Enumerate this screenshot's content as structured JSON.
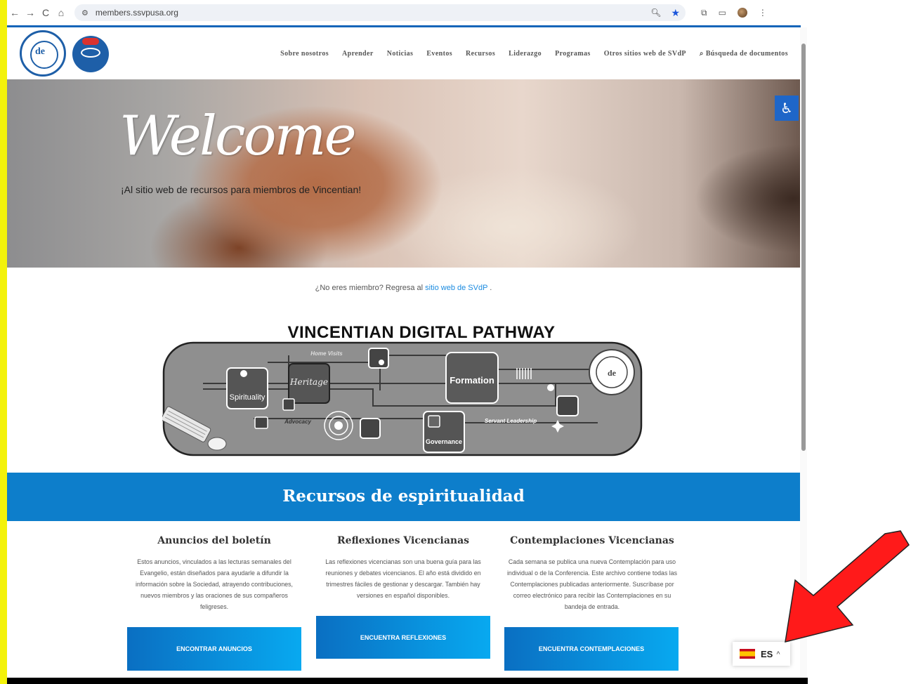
{
  "browser": {
    "url": "members.ssvpusa.org",
    "back_icon": "←",
    "forward_icon": "→",
    "reload_icon": "C",
    "home_icon": "⌂"
  },
  "header": {
    "logo_text": "de",
    "menu": [
      "Sobre nosotros",
      "Aprender",
      "Noticias",
      "Eventos",
      "Recursos",
      "Liderazgo",
      "Programas",
      "Otros sitios web de SVdP",
      "Búsqueda de documentos"
    ]
  },
  "hero": {
    "welcome": "Welcome",
    "subtitle": "¡Al sitio web de recursos para miembros de Vincentian!"
  },
  "notmember": {
    "prefix": "¿No eres miembro? Regresa al ",
    "link": "sitio web de SVdP",
    "suffix": " ."
  },
  "pathway": {
    "title": "VINCENTIAN DIGITAL PATHWAY",
    "labels": {
      "home_visits": "Home Visits",
      "heritage": "Heritage",
      "spirituality": "Spirituality",
      "advocacy": "Advocacy",
      "formation": "Formation",
      "governance": "Governance",
      "servant_leadership": "Servant Leadership",
      "logo_mark": "de"
    }
  },
  "resources": {
    "band_title": "Recursos de espiritualidad",
    "columns": [
      {
        "title": "Anuncios del boletín",
        "text": "Estos anuncios, vinculados a las lecturas semanales del Evangelio, están diseñados para ayudarle a difundir la información sobre la Sociedad, atrayendo contribuciones, nuevos miembros y las oraciones de sus compañeros feligreses.",
        "button": "ENCONTRAR ANUNCIOS"
      },
      {
        "title": "Reflexiones Vicencianas",
        "text": "Las reflexiones vicencianas son una buena guía para las reuniones y debates vicencianos. El año está dividido en trimestres fáciles de gestionar y descargar. También hay versiones en español disponibles.",
        "button": "ENCUENTRA REFLEXIONES"
      },
      {
        "title": "Contemplaciones Vicencianas",
        "text": "Cada semana se publica una nueva Contemplación para uso individual o de la Conferencia. Este archivo contiene todas las Contemplaciones publicadas anteriormente. Suscríbase por correo electrónico para recibir las Contemplaciones en su bandeja de entrada.",
        "button": "ENCUENTRA CONTEMPLACIONES"
      }
    ]
  },
  "language": {
    "code": "ES"
  },
  "colors": {
    "brand_blue": "#0d7ecb",
    "link_blue": "#1b8be0",
    "highlight_yellow": "#f3f20a",
    "arrow_red": "#ff1a1a"
  }
}
